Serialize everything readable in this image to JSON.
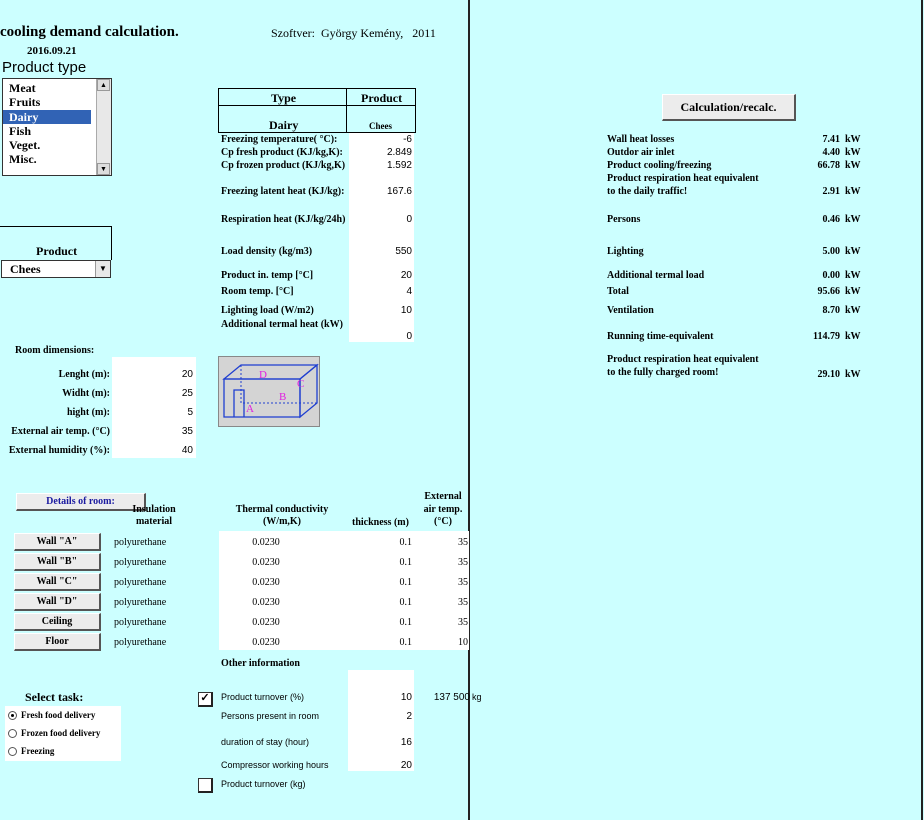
{
  "header": {
    "title": "cooling demand calculation.",
    "date": "2016.09.21",
    "software": "Szoftver:  György Kemény,   2011"
  },
  "product_type": {
    "label": "Product type",
    "items": [
      "Meat",
      "Fruits",
      "Dairy",
      "Fish",
      "Veget.",
      "Misc."
    ],
    "selected": "Dairy"
  },
  "product_select": {
    "label": "Product",
    "value": "Chees"
  },
  "type_table": {
    "col_type": "Type",
    "col_product": "Product",
    "type_value": "Dairy",
    "product_value": "Chees"
  },
  "parameters": [
    {
      "label": "Freezing temperature( °C):",
      "value": "-6"
    },
    {
      "label": "Cp fresh product (KJ/kg,K):",
      "value": "2.849"
    },
    {
      "label": "Cp frozen product (KJ/kg,K)",
      "value": "1.592"
    },
    {
      "label": "Freezing latent heat (KJ/kg):",
      "value": "167.6"
    },
    {
      "label": "Respiration heat (KJ/kg/24h)",
      "value": "0"
    },
    {
      "label": "Load density (kg/m3)",
      "value": "550"
    },
    {
      "label": "Product in. temp [°C]",
      "value": "20"
    },
    {
      "label": "Room temp. [°C]",
      "value": "4"
    },
    {
      "label": "Lighting load  (W/m2)",
      "value": "10"
    },
    {
      "label": "Additional termal heat (kW)",
      "value": "0"
    }
  ],
  "room": {
    "label": "Room dimensions:",
    "fields": [
      {
        "label": "Lenght (m):",
        "value": "20"
      },
      {
        "label": "Widht (m):",
        "value": "25"
      },
      {
        "label": "hight (m):",
        "value": "5"
      },
      {
        "label": "External air temp. (°C)",
        "value": "35"
      },
      {
        "label": "External humidity (%):",
        "value": "40"
      }
    ],
    "diagram_letters": [
      "A",
      "B",
      "C",
      "D"
    ]
  },
  "calc_button": "Calculation/recalc.",
  "results": [
    {
      "label": "Wall heat losses",
      "value": "7.41",
      "unit": "kW"
    },
    {
      "label": "Outdor air inlet",
      "value": "4.40",
      "unit": "kW"
    },
    {
      "label": "Product cooling/freezing",
      "value": "66.78",
      "unit": "kW"
    },
    {
      "label": "Product respiration heat equivalent",
      "label2": "to the daily traffic!",
      "value": "2.91",
      "unit": "kW"
    },
    {
      "label": "Persons",
      "value": "0.46",
      "unit": "kW"
    },
    {
      "label": "Lighting",
      "value": "5.00",
      "unit": "kW"
    },
    {
      "label": "Additional termal load",
      "value": "0.00",
      "unit": "kW"
    },
    {
      "label": "Total",
      "value": "95.66",
      "unit": "kW"
    },
    {
      "label": "Ventilation",
      "value": "8.70",
      "unit": "kW"
    },
    {
      "label": "Running time-equivalent",
      "value": "114.79",
      "unit": "kW"
    },
    {
      "label": "Product respiration heat equivalent",
      "label2": "to the fully charged room!",
      "value": "29.10",
      "unit": "kW"
    }
  ],
  "walls": {
    "details_button": "Details of room:",
    "col_insulation": "Insulation material",
    "col_conductivity": "Thermal conductivity (W/m,K)",
    "col_thickness": "thickness (m)",
    "col_ext": "External air temp. (°C)",
    "rows": [
      {
        "button": "Wall \"A\"",
        "material": "polyurethane",
        "conductivity": "0.0230",
        "thickness": "0.1",
        "ext": "35"
      },
      {
        "button": "Wall \"B\"",
        "material": "polyurethane",
        "conductivity": "0.0230",
        "thickness": "0.1",
        "ext": "35"
      },
      {
        "button": "Wall \"C\"",
        "material": "polyurethane",
        "conductivity": "0.0230",
        "thickness": "0.1",
        "ext": "35"
      },
      {
        "button": "Wall \"D\"",
        "material": "polyurethane",
        "conductivity": "0.0230",
        "thickness": "0.1",
        "ext": "35"
      },
      {
        "button": "Ceiling",
        "material": "polyurethane",
        "conductivity": "0.0230",
        "thickness": "0.1",
        "ext": "35"
      },
      {
        "button": "Floor",
        "material": "polyurethane",
        "conductivity": "0.0230",
        "thickness": "0.1",
        "ext": "10"
      }
    ]
  },
  "other": {
    "label": "Other information",
    "turnover_pct_label": "Product turnover  (%)",
    "turnover_pct_value": "10",
    "turnover_kg_value": "137 500",
    "turnover_kg_unit": "kg",
    "persons_label": "Persons present in room",
    "persons_value": "2",
    "duration_label": "duration of stay  (hour)",
    "duration_value": "16",
    "compressor_label": "Compressor working hours",
    "compressor_value": "20",
    "turnover_kg_label": "Product turnover (kg)",
    "turnover_pct_checked": true,
    "turnover_kg_checked": false
  },
  "task": {
    "label": "Select task:",
    "options": [
      "Fresh food delivery",
      "Frozen food delivery",
      "Freezing"
    ],
    "selected": "Fresh food delivery"
  }
}
